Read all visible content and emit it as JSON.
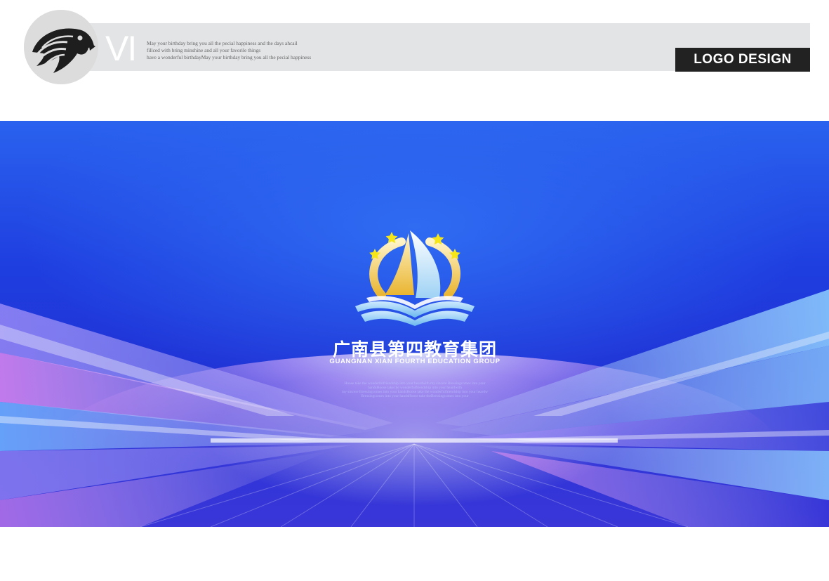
{
  "header": {
    "vi_label": "VI",
    "tagline_lines": [
      "May your birthday bring you all the pecial happiness and  the days ahcail",
      "fillced with bring  minshine and all your favorile things",
      "have a wonderful birthdayMay your birthday bring you all the pecial happiness"
    ],
    "logo_design_label": "LOGO DESIGN"
  },
  "brand": {
    "name_cn": "广南县第四教育集团",
    "name_en": "GUANGNAN XIAN  FOURTH EDUCATION GROUP",
    "blurb_lines": [
      "Hoose take the wonderfulfriendship into your heardwith my sincere Bressingcomes into your",
      "handsHoose take the wonderfulfriendship into your heardwith",
      "my sincere Bressingcomes into your handsHoose take the wonderfulfriendship into your heardw",
      "Bressingcomes into your handsHoose take theBressingcomes into your"
    ]
  },
  "colors": {
    "header_band": "#e3e4e6",
    "logo_design_bg": "#222222",
    "hero_blue": "#2033d6",
    "star_yellow": "#f5e61a",
    "sail_gold": "#f0c64a",
    "book_blue": "#7cc4f2"
  },
  "icons": {
    "eagle": "eagle-head-icon",
    "logo": "sailboat-book-emblem"
  }
}
